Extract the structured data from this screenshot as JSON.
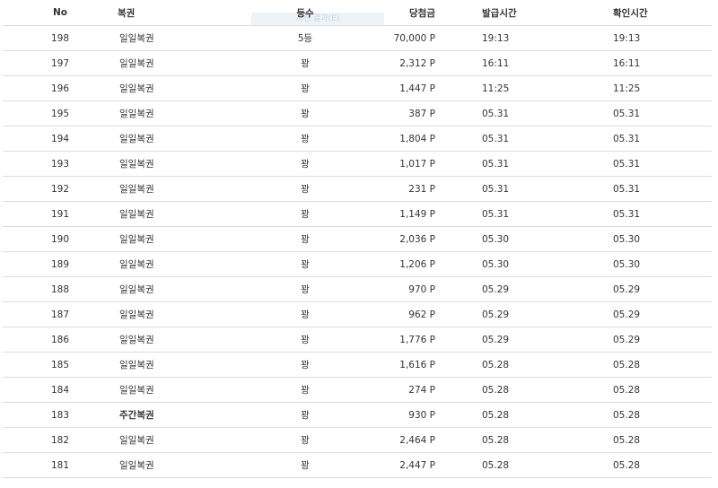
{
  "ghost_label": "사전 결과(E)",
  "columns": {
    "no": "No",
    "type": "복권",
    "rank": "등수",
    "prize": "당첨금",
    "issued": "발급시간",
    "checked": "확인시간"
  },
  "rows": [
    {
      "no": "198",
      "type": "일일복권",
      "rank": "5등",
      "prize": "70,000 P",
      "issued": "19:13",
      "checked": "19:13",
      "bold": false
    },
    {
      "no": "197",
      "type": "일일복권",
      "rank": "꽝",
      "prize": "2,312 P",
      "issued": "16:11",
      "checked": "16:11",
      "bold": false
    },
    {
      "no": "196",
      "type": "일일복권",
      "rank": "꽝",
      "prize": "1,447 P",
      "issued": "11:25",
      "checked": "11:25",
      "bold": false
    },
    {
      "no": "195",
      "type": "일일복권",
      "rank": "꽝",
      "prize": "387 P",
      "issued": "05.31",
      "checked": "05.31",
      "bold": false
    },
    {
      "no": "194",
      "type": "일일복권",
      "rank": "꽝",
      "prize": "1,804 P",
      "issued": "05.31",
      "checked": "05.31",
      "bold": false
    },
    {
      "no": "193",
      "type": "일일복권",
      "rank": "꽝",
      "prize": "1,017 P",
      "issued": "05.31",
      "checked": "05.31",
      "bold": false
    },
    {
      "no": "192",
      "type": "일일복권",
      "rank": "꽝",
      "prize": "231 P",
      "issued": "05.31",
      "checked": "05.31",
      "bold": false
    },
    {
      "no": "191",
      "type": "일일복권",
      "rank": "꽝",
      "prize": "1,149 P",
      "issued": "05.31",
      "checked": "05.31",
      "bold": false
    },
    {
      "no": "190",
      "type": "일일복권",
      "rank": "꽝",
      "prize": "2,036 P",
      "issued": "05.30",
      "checked": "05.30",
      "bold": false
    },
    {
      "no": "189",
      "type": "일일복권",
      "rank": "꽝",
      "prize": "1,206 P",
      "issued": "05.30",
      "checked": "05.30",
      "bold": false
    },
    {
      "no": "188",
      "type": "일일복권",
      "rank": "꽝",
      "prize": "970 P",
      "issued": "05.29",
      "checked": "05.29",
      "bold": false
    },
    {
      "no": "187",
      "type": "일일복권",
      "rank": "꽝",
      "prize": "962 P",
      "issued": "05.29",
      "checked": "05.29",
      "bold": false
    },
    {
      "no": "186",
      "type": "일일복권",
      "rank": "꽝",
      "prize": "1,776 P",
      "issued": "05.29",
      "checked": "05.29",
      "bold": false
    },
    {
      "no": "185",
      "type": "일일복권",
      "rank": "꽝",
      "prize": "1,616 P",
      "issued": "05.28",
      "checked": "05.28",
      "bold": false
    },
    {
      "no": "184",
      "type": "일일복권",
      "rank": "꽝",
      "prize": "274 P",
      "issued": "05.28",
      "checked": "05.28",
      "bold": false
    },
    {
      "no": "183",
      "type": "주간복권",
      "rank": "꽝",
      "prize": "930 P",
      "issued": "05.28",
      "checked": "05.28",
      "bold": true
    },
    {
      "no": "182",
      "type": "일일복권",
      "rank": "꽝",
      "prize": "2,464 P",
      "issued": "05.28",
      "checked": "05.28",
      "bold": false
    },
    {
      "no": "181",
      "type": "일일복권",
      "rank": "꽝",
      "prize": "2,447 P",
      "issued": "05.28",
      "checked": "05.28",
      "bold": false
    }
  ]
}
